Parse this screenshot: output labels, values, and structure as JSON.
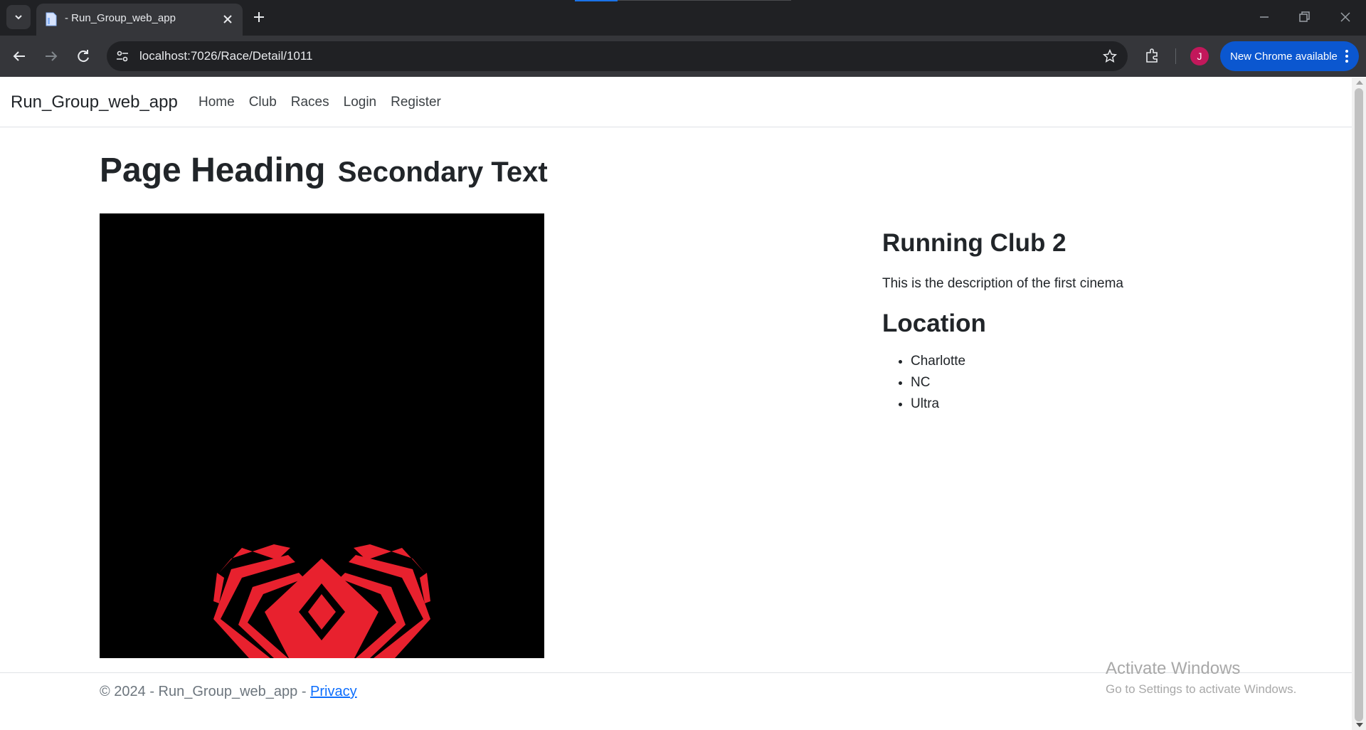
{
  "browser": {
    "tab": {
      "title": "- Run_Group_web_app"
    },
    "url": "localhost:7026/Race/Detail/1011",
    "avatar_letter": "J",
    "update_label": "New Chrome available"
  },
  "navbar": {
    "brand": "Run_Group_web_app",
    "links": [
      "Home",
      "Club",
      "Races",
      "Login",
      "Register"
    ]
  },
  "page": {
    "heading": "Page Heading",
    "secondary": "Secondary Text"
  },
  "club": {
    "title": "Running Club 2",
    "description": "This is the description of the first cinema"
  },
  "location": {
    "title": "Location",
    "items": [
      "Charlotte",
      "NC",
      "Ultra"
    ]
  },
  "footer": {
    "text": "© 2024 - Run_Group_web_app - ",
    "privacy_link": "Privacy"
  },
  "watermark": {
    "title": "Activate Windows",
    "subtitle": "Go to Settings to activate Windows."
  },
  "colors": {
    "chrome_dark": "#202124",
    "chrome_toolbar": "#35363a",
    "update_button": "#0b57d0",
    "avatar": "#c2185b",
    "logo_red": "#e8212e",
    "link": "#0d6efd"
  },
  "icons": [
    "tab-list-icon",
    "page-favicon-icon",
    "close-icon",
    "plus-icon",
    "back-icon",
    "forward-icon",
    "reload-icon",
    "site-info-icon",
    "star-icon",
    "extensions-icon",
    "more-vertical-icon",
    "minimize-icon",
    "restore-icon",
    "window-close-icon"
  ]
}
